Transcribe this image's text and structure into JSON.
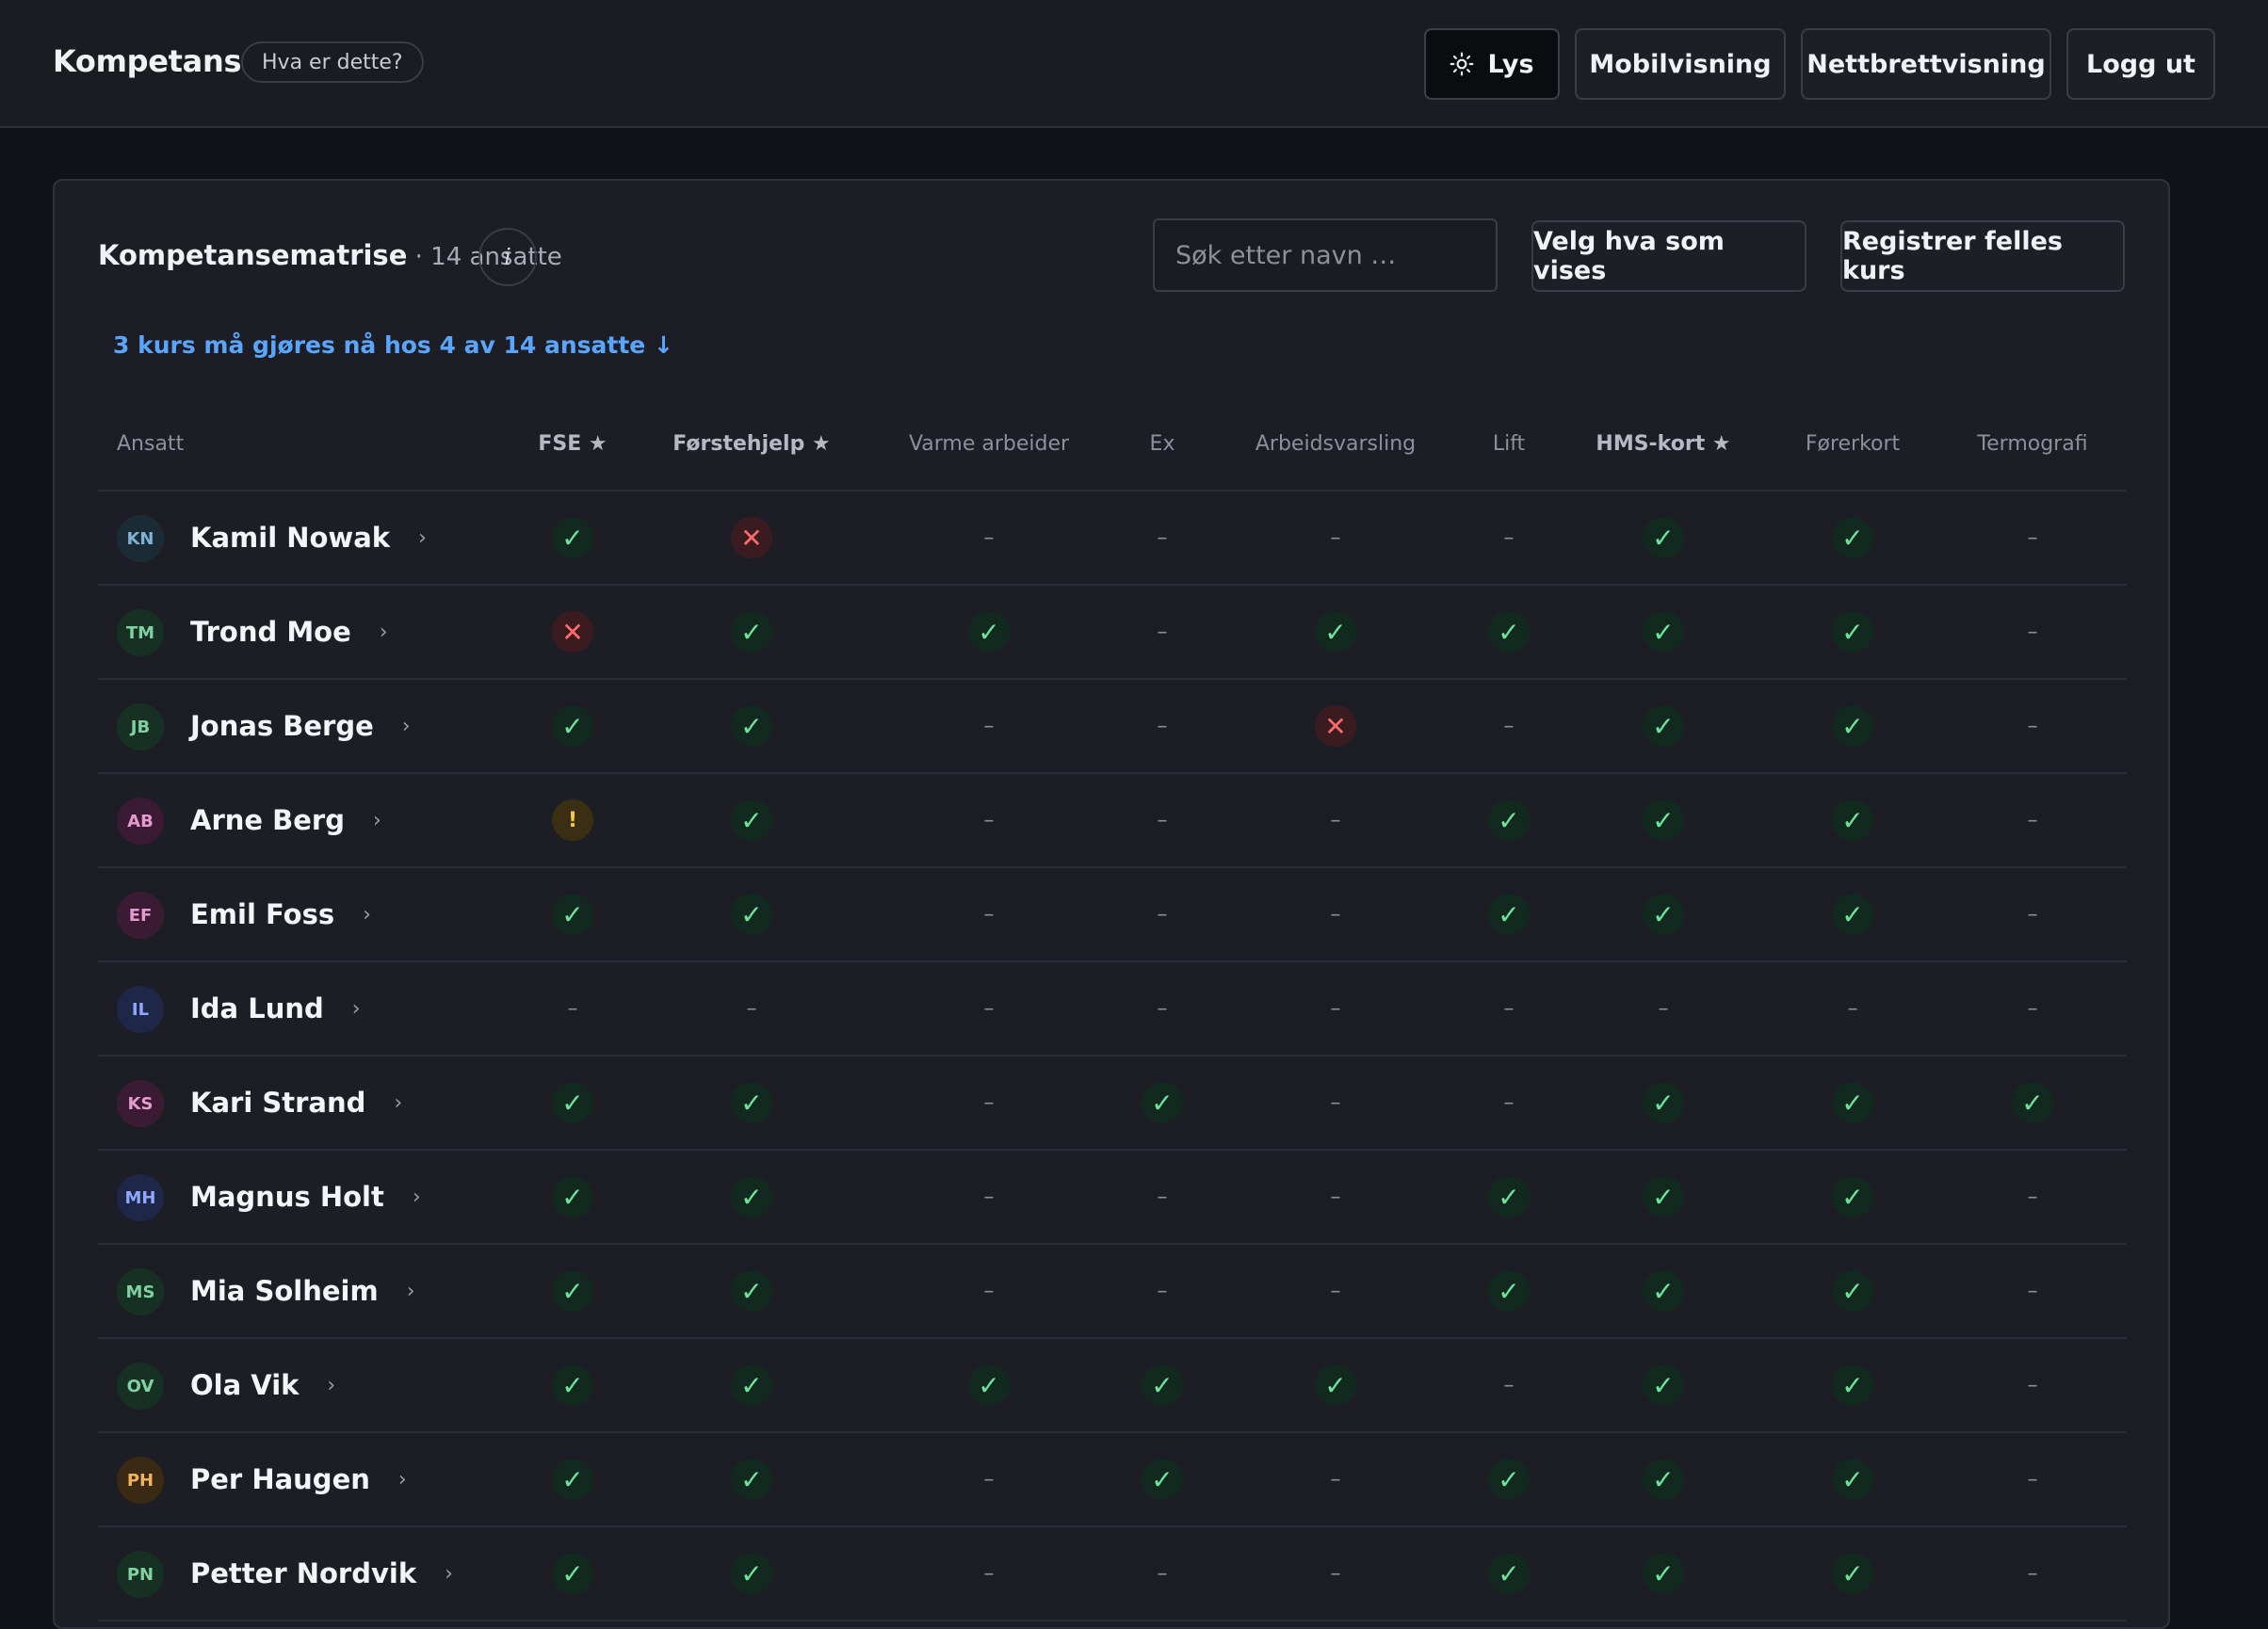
{
  "header": {
    "brand": "Kompetanse",
    "help": "Hva er dette?",
    "buttons": {
      "theme": "Lys",
      "mobile": "Mobilvisning",
      "tablet": "Nettbrettvisning",
      "logout": "Logg ut"
    }
  },
  "card": {
    "title": "Kompetansematrise",
    "subtitle": " · 14 ansatte",
    "info": "i",
    "search_placeholder": "Søk etter navn …",
    "select_label": "Velg hva som vises",
    "register_label": "Registrer felles kurs",
    "alert": "3 kurs må gjøres nå hos 4 av 14 ansatte ↓"
  },
  "table": {
    "first_col": "Ansatt",
    "columns": [
      {
        "label": "FSE ★",
        "required": true
      },
      {
        "label": "Førstehjelp ★",
        "required": true
      },
      {
        "label": "Varme arbeider",
        "required": false
      },
      {
        "label": "Ex",
        "required": false
      },
      {
        "label": "Arbeidsvarsling",
        "required": false
      },
      {
        "label": "Lift",
        "required": false
      },
      {
        "label": "HMS-kort ★",
        "required": true
      },
      {
        "label": "Førerkort",
        "required": false
      },
      {
        "label": "Termografi",
        "required": false
      }
    ],
    "status_glyphs": {
      "ok": "✓",
      "missing": "✕",
      "warn": "!",
      "none": "–"
    },
    "rows": [
      {
        "initials": "KN",
        "name": "Kamil Nowak",
        "color": "#7fb3d5",
        "bg": "#1a2b35",
        "status": [
          "ok",
          "missing",
          "none",
          "none",
          "none",
          "none",
          "ok",
          "ok",
          "none"
        ]
      },
      {
        "initials": "TM",
        "name": "Trond Moe",
        "color": "#7fd1a0",
        "bg": "#163024",
        "status": [
          "missing",
          "ok",
          "ok",
          "none",
          "ok",
          "ok",
          "ok",
          "ok",
          "none"
        ]
      },
      {
        "initials": "JB",
        "name": "Jonas Berge",
        "color": "#7fd1a0",
        "bg": "#163024",
        "status": [
          "ok",
          "ok",
          "none",
          "none",
          "missing",
          "none",
          "ok",
          "ok",
          "none"
        ]
      },
      {
        "initials": "AB",
        "name": "Arne Berg",
        "color": "#e79ad0",
        "bg": "#3a1b33",
        "status": [
          "warn",
          "ok",
          "none",
          "none",
          "none",
          "ok",
          "ok",
          "ok",
          "none"
        ]
      },
      {
        "initials": "EF",
        "name": "Emil Foss",
        "color": "#e79ad0",
        "bg": "#3a1b33",
        "status": [
          "ok",
          "ok",
          "none",
          "none",
          "none",
          "ok",
          "ok",
          "ok",
          "none"
        ]
      },
      {
        "initials": "IL",
        "name": "Ida Lund",
        "color": "#8fa8ff",
        "bg": "#1e2748",
        "status": [
          "none",
          "none",
          "none",
          "none",
          "none",
          "none",
          "none",
          "none",
          "none"
        ]
      },
      {
        "initials": "KS",
        "name": "Kari Strand",
        "color": "#e79ad0",
        "bg": "#3a1b33",
        "status": [
          "ok",
          "ok",
          "none",
          "ok",
          "none",
          "none",
          "ok",
          "ok",
          "ok"
        ]
      },
      {
        "initials": "MH",
        "name": "Magnus Holt",
        "color": "#8fa8ff",
        "bg": "#1e2748",
        "status": [
          "ok",
          "ok",
          "none",
          "none",
          "none",
          "ok",
          "ok",
          "ok",
          "none"
        ]
      },
      {
        "initials": "MS",
        "name": "Mia Solheim",
        "color": "#7fd1a0",
        "bg": "#163024",
        "status": [
          "ok",
          "ok",
          "none",
          "none",
          "none",
          "ok",
          "ok",
          "ok",
          "none"
        ]
      },
      {
        "initials": "OV",
        "name": "Ola Vik",
        "color": "#7fd1a0",
        "bg": "#163024",
        "status": [
          "ok",
          "ok",
          "ok",
          "ok",
          "ok",
          "none",
          "ok",
          "ok",
          "none"
        ]
      },
      {
        "initials": "PH",
        "name": "Per Haugen",
        "color": "#f0b35a",
        "bg": "#3a2a14",
        "status": [
          "ok",
          "ok",
          "none",
          "ok",
          "none",
          "ok",
          "ok",
          "ok",
          "none"
        ]
      },
      {
        "initials": "PN",
        "name": "Petter Nordvik",
        "color": "#7fd1a0",
        "bg": "#163024",
        "status": [
          "ok",
          "ok",
          "none",
          "none",
          "none",
          "ok",
          "ok",
          "ok",
          "none"
        ]
      }
    ]
  }
}
